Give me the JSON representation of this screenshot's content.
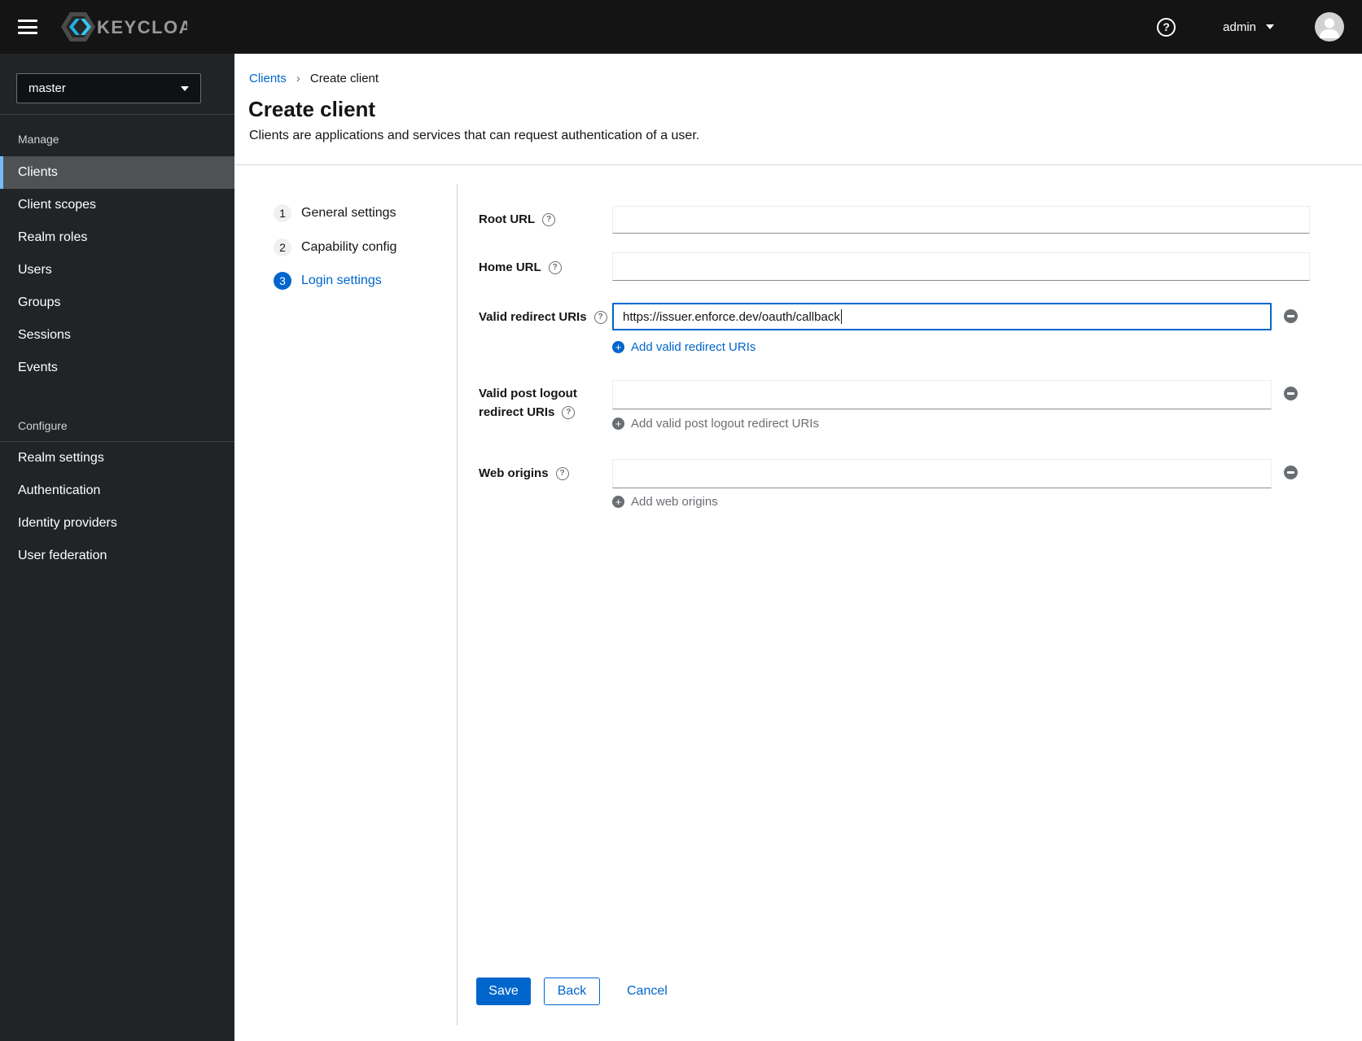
{
  "topbar": {
    "brand": "KEYCLOAK",
    "username": "admin"
  },
  "sidebar": {
    "realm_selector": {
      "value": "master"
    },
    "sections": [
      {
        "label": "Manage",
        "items": [
          {
            "label": "Clients",
            "active": true
          },
          {
            "label": "Client scopes",
            "active": false
          },
          {
            "label": "Realm roles",
            "active": false
          },
          {
            "label": "Users",
            "active": false
          },
          {
            "label": "Groups",
            "active": false
          },
          {
            "label": "Sessions",
            "active": false
          },
          {
            "label": "Events",
            "active": false
          }
        ]
      },
      {
        "label": "Configure",
        "items": [
          {
            "label": "Realm settings",
            "active": false
          },
          {
            "label": "Authentication",
            "active": false
          },
          {
            "label": "Identity providers",
            "active": false
          },
          {
            "label": "User federation",
            "active": false
          }
        ]
      }
    ]
  },
  "breadcrumb": {
    "items": [
      {
        "label": "Clients",
        "link": true
      },
      {
        "label": "Create client",
        "link": false
      }
    ]
  },
  "page": {
    "title": "Create client",
    "subtitle": "Clients are applications and services that can request authentication of a user."
  },
  "wizard": {
    "steps": [
      {
        "number": "1",
        "label": "General settings",
        "active": false
      },
      {
        "number": "2",
        "label": "Capability config",
        "active": false
      },
      {
        "number": "3",
        "label": "Login settings",
        "active": true
      }
    ]
  },
  "form": {
    "root_url": {
      "label": "Root URL",
      "value": ""
    },
    "home_url": {
      "label": "Home URL",
      "value": ""
    },
    "valid_redirect_uris": {
      "label": "Valid redirect URIs",
      "value": "https://issuer.enforce.dev/oauth/callback",
      "add_label": "Add valid redirect URIs",
      "add_enabled": true
    },
    "valid_post_logout_redirect_uris": {
      "label_line1": "Valid post logout",
      "label_line2": "redirect URIs",
      "value": "",
      "add_label": "Add valid post logout redirect URIs",
      "add_enabled": false
    },
    "web_origins": {
      "label": "Web origins",
      "value": "",
      "add_label": "Add web origins",
      "add_enabled": false
    }
  },
  "actions": {
    "save": "Save",
    "back": "Back",
    "cancel": "Cancel"
  },
  "icons": {
    "help_glyph": "?",
    "plus_glyph": "+",
    "breadcrumb_separator": "›"
  },
  "colors": {
    "accent_blue": "#0066cc",
    "topbar_bg": "#141414",
    "sidebar_bg": "#212427",
    "active_nav_bg": "#4f5255",
    "active_nav_border": "#73bcf7",
    "muted_gray": "#6a6e73"
  }
}
